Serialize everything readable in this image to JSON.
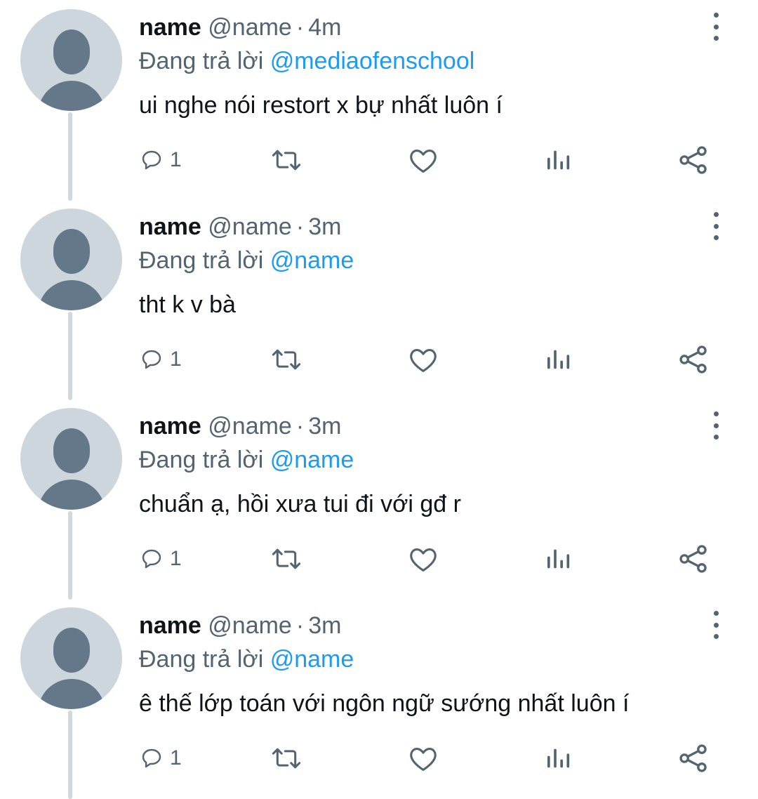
{
  "reply_prefix": "Đang trả lời",
  "separator": "·",
  "colors": {
    "mention": "#1d9bf0",
    "secondary_text": "#536471",
    "thread_line": "#cfd9de",
    "avatar_bg": "#cdd6dd",
    "avatar_fg": "#65788a"
  },
  "icons": {
    "reply": "speech-bubble-icon",
    "retweet": "retweet-icon",
    "like": "heart-icon",
    "views": "bar-chart-icon",
    "share": "share-icon",
    "more": "three-dots-vertical-icon"
  },
  "tweets": [
    {
      "name": "name",
      "handle": "@name",
      "time": "4m",
      "replying_to": "@mediaofenschool",
      "text": "ui nghe nói restort x bự nhất luôn í",
      "reply_count": "1"
    },
    {
      "name": "name",
      "handle": "@name",
      "time": "3m",
      "replying_to": "@name",
      "text": "tht k v bà",
      "reply_count": "1"
    },
    {
      "name": "name",
      "handle": "@name",
      "time": "3m",
      "replying_to": "@name",
      "text": "chuẩn ạ, hồi xưa tui đi với gđ r",
      "reply_count": "1"
    },
    {
      "name": "name",
      "handle": "@name",
      "time": "3m",
      "replying_to": "@name",
      "text": "ê thế lớp toán với ngôn ngữ sướng nhất luôn í",
      "reply_count": "1"
    }
  ]
}
